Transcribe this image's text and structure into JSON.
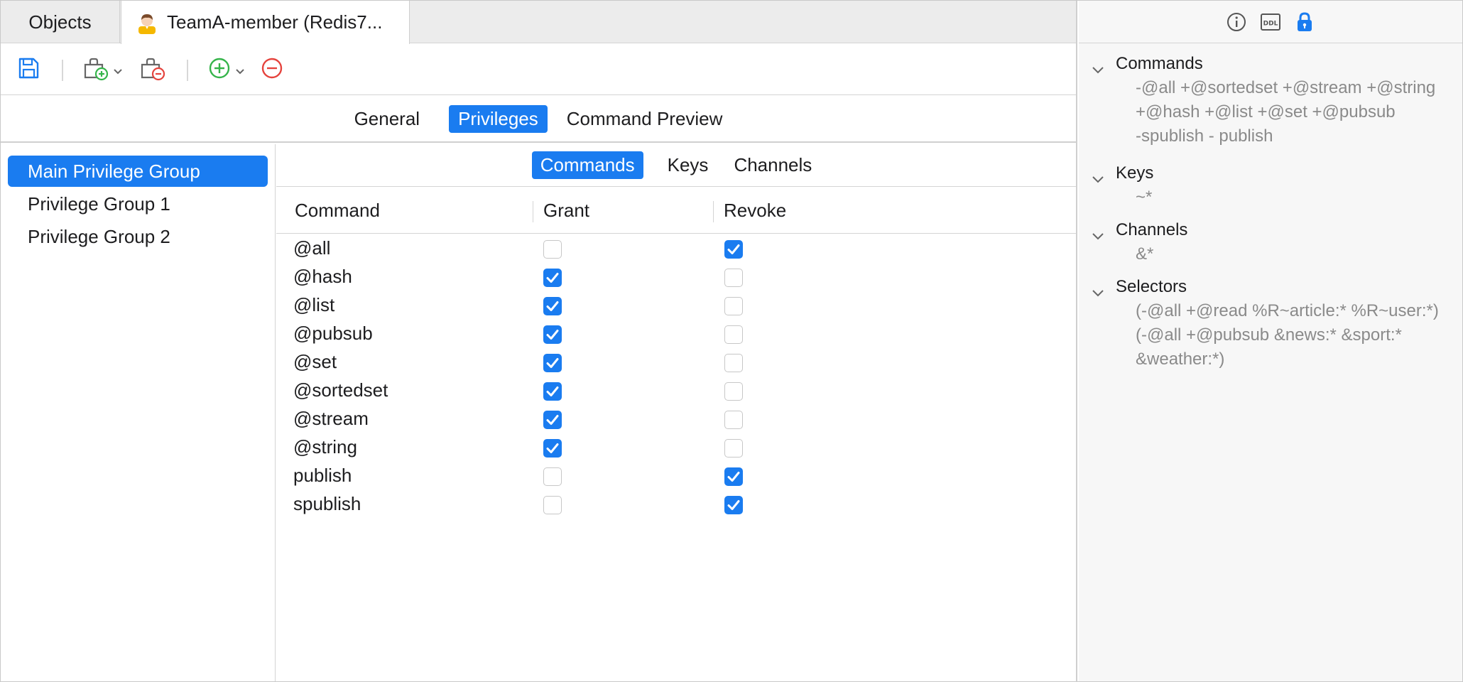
{
  "tabs": {
    "objects": "Objects",
    "active": "TeamA-member (Redis7..."
  },
  "toolbar": {
    "save": "save-icon",
    "add_group": "add-group-icon",
    "remove_group": "remove-group-icon",
    "add": "add-icon",
    "remove": "remove-icon"
  },
  "section_tabs": [
    "General",
    "Privileges",
    "Command Preview"
  ],
  "groups": [
    "Main Privilege Group",
    "Privilege Group 1",
    "Privilege Group 2"
  ],
  "sub_tabs": [
    "Commands",
    "Keys",
    "Channels"
  ],
  "columns": [
    "Command",
    "Grant",
    "Revoke"
  ],
  "rows": [
    {
      "command": "@all",
      "grant": false,
      "revoke": true
    },
    {
      "command": "@hash",
      "grant": true,
      "revoke": false
    },
    {
      "command": "@list",
      "grant": true,
      "revoke": false
    },
    {
      "command": "@pubsub",
      "grant": true,
      "revoke": false
    },
    {
      "command": "@set",
      "grant": true,
      "revoke": false
    },
    {
      "command": "@sortedset",
      "grant": true,
      "revoke": false
    },
    {
      "command": "@stream",
      "grant": true,
      "revoke": false
    },
    {
      "command": "@string",
      "grant": true,
      "revoke": false
    },
    {
      "command": "publish",
      "grant": false,
      "revoke": true
    },
    {
      "command": "spublish",
      "grant": false,
      "revoke": true
    }
  ],
  "side": {
    "commands_title": "Commands",
    "commands_lines": [
      "-@all +@sortedset +@stream +@string",
      "+@hash +@list +@set +@pubsub",
      "-spublish - publish"
    ],
    "keys_title": "Keys",
    "keys_lines": [
      "~*"
    ],
    "channels_title": "Channels",
    "channels_lines": [
      "&*"
    ],
    "selectors_title": "Selectors",
    "selectors_lines": [
      "(-@all +@read %R~article:* %R~user:*)",
      "(-@all +@pubsub &news:* &sport:*",
      "&weather:*)"
    ]
  },
  "colors": {
    "accent": "#1a7cf0",
    "add_green": "#35b44a",
    "remove_red": "#e5433d"
  }
}
